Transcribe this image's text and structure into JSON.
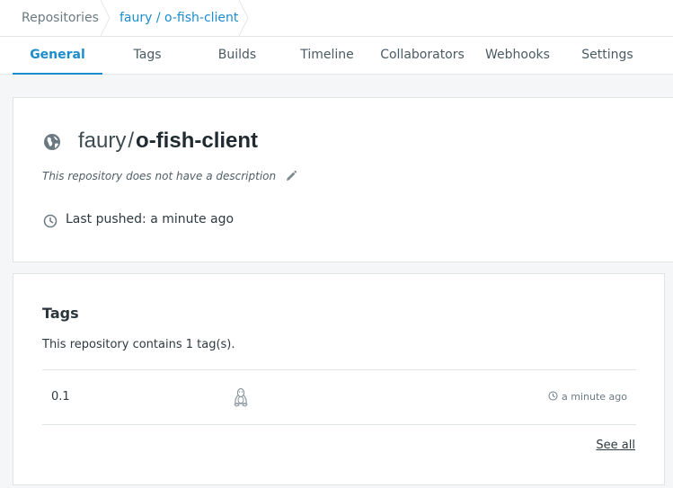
{
  "breadcrumb": {
    "root": "Repositories",
    "current": "faury / o-fish-client"
  },
  "tabs": [
    {
      "label": "General",
      "active": true
    },
    {
      "label": "Tags",
      "active": false
    },
    {
      "label": "Builds",
      "active": false
    },
    {
      "label": "Timeline",
      "active": false
    },
    {
      "label": "Collaborators",
      "active": false
    },
    {
      "label": "Webhooks",
      "active": false
    },
    {
      "label": "Settings",
      "active": false
    }
  ],
  "repo": {
    "namespace": "faury",
    "separator": "/",
    "name": "o-fish-client",
    "description": "This repository does not have a description",
    "last_pushed": "Last pushed: a minute ago",
    "visibility_icon": "globe-icon"
  },
  "tags_section": {
    "title": "Tags",
    "summary": "This repository contains 1 tag(s).",
    "items": [
      {
        "name": "0.1",
        "os_icon": "linux-icon",
        "time": "a minute ago"
      }
    ],
    "see_all": "See all"
  },
  "colors": {
    "accent": "#1b8ccc",
    "background": "#f4f6f7",
    "border": "#dfe4e6"
  }
}
